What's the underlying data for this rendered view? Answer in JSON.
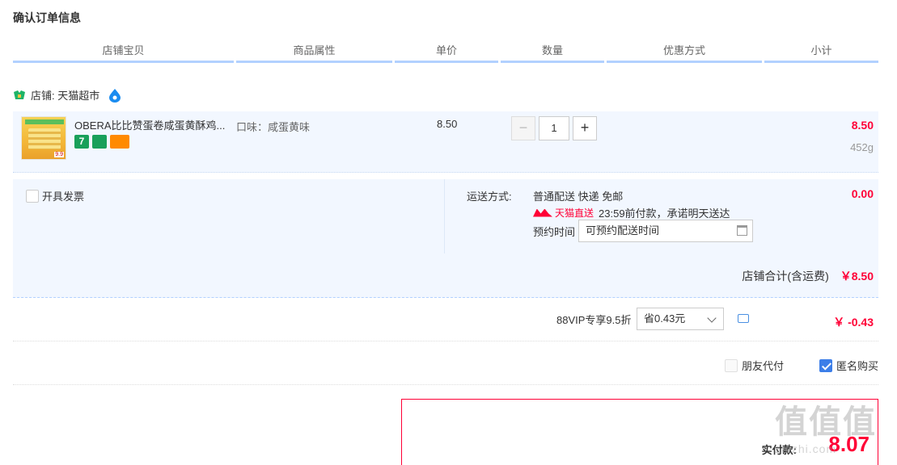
{
  "page": {
    "title": "确认订单信息"
  },
  "columns": [
    "店铺宝贝",
    "商品属性",
    "单价",
    "数量",
    "优惠方式",
    "小计"
  ],
  "shop": {
    "label": "店铺: 天猫超市"
  },
  "item": {
    "title": "OBERA比比赞蛋卷咸蛋黄酥鸡...",
    "attr": "口味：咸蛋黄味",
    "price": "8.50",
    "quantity": "1",
    "minus": "−",
    "plus": "+",
    "subtotal": "8.50",
    "weight": "452g",
    "badge_seven": "7"
  },
  "service": {
    "invoice_label": "开具发票",
    "ship_label": "运送方式:",
    "ship_method": "普通配送 快递 免邮",
    "ship_fee": "0.00",
    "tmall_direct": "天猫直送",
    "promise": "23:59前付款，承诺明天送达",
    "appointment_label": "预约时间",
    "appointment_placeholder": "可预约配送时间"
  },
  "shop_total": {
    "label": "店铺合计(含运费)",
    "value": "￥8.50"
  },
  "vip": {
    "label": "88VIP专享9.5折",
    "selected": "省0.43元",
    "value": "￥ -0.43"
  },
  "options": {
    "friend_pay": "朋友代付",
    "anonymous": "匿名购买",
    "anonymous_checked": true,
    "friend_pay_checked": false
  },
  "payment": {
    "label": "实付款:",
    "value": "8.07"
  },
  "watermark": {
    "text": "值值值",
    "sub": "zhizhi.com"
  }
}
